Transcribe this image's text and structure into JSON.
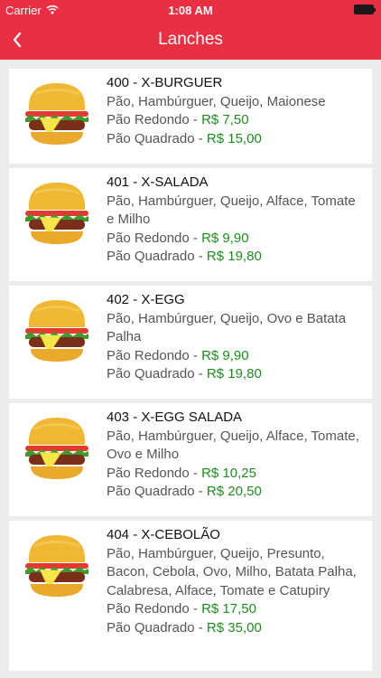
{
  "status_bar": {
    "carrier": "Carrier",
    "time": "1:08 AM"
  },
  "nav": {
    "title": "Lanches"
  },
  "items": [
    {
      "name": "400 - X-BURGUER",
      "description": "Pão, Hambúrguer, Queijo, Maionese",
      "round_label": "Pão Redondo - ",
      "round_price": "R$ 7,50",
      "square_label": "Pão Quadrado - ",
      "square_price": "R$ 15,00"
    },
    {
      "name": "401 - X-SALADA",
      "description": "Pão, Hambúrguer, Queijo, Alface, Tomate e Milho",
      "round_label": "Pão Redondo - ",
      "round_price": "R$ 9,90",
      "square_label": "Pão Quadrado - ",
      "square_price": "R$ 19,80"
    },
    {
      "name": "402 - X-EGG",
      "description": "Pão, Hambúrguer, Queijo, Ovo e Batata Palha",
      "round_label": "Pão Redondo - ",
      "round_price": "R$ 9,90",
      "square_label": "Pão Quadrado - ",
      "square_price": "R$ 19,80"
    },
    {
      "name": "403 - X-EGG SALADA",
      "description": "Pão, Hambúrguer, Queijo, Alface, Tomate, Ovo e Milho",
      "round_label": "Pão Redondo - ",
      "round_price": "R$ 10,25",
      "square_label": "Pão Quadrado - ",
      "square_price": "R$ 20,50"
    },
    {
      "name": "404 - X-CEBOLÃO",
      "description": "Pão, Hambúrguer, Queijo, Presunto, Bacon, Cebola, Ovo, Milho, Batata Palha, Calabresa, Alface, Tomate e Catupiry",
      "round_label": "Pão Redondo - ",
      "round_price": "R$ 17,50",
      "square_label": "Pão Quadrado - ",
      "square_price": "R$ 35,00"
    }
  ],
  "icons": {
    "back": "chevron-left-icon",
    "wifi": "wifi-icon",
    "battery": "battery-icon",
    "food": "burger-icon"
  },
  "colors": {
    "header": "#ea2f42",
    "price": "#1e8c1e",
    "background": "#ececec"
  }
}
